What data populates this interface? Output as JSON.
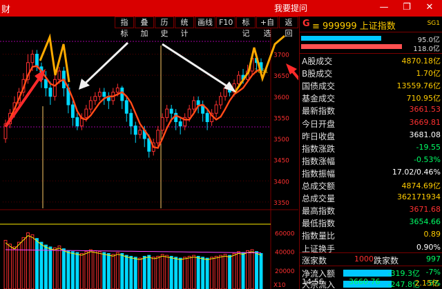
{
  "titlebar": {
    "app": "财",
    "help": "我要提问",
    "min": "—",
    "restore": "❐",
    "close": "✕"
  },
  "toolbar": {
    "items": [
      "指标",
      "叠加",
      "历史",
      "统计",
      "画线",
      "F10",
      "标记",
      "+自选",
      "返回"
    ]
  },
  "quote": {
    "market": "G",
    "code_name": "≡  999999  上证指数",
    "sg": "SG1",
    "bar1_value": "95.0亿",
    "bar2_value": "118.0亿"
  },
  "stats": [
    {
      "label": "A股成交",
      "value": "4870.18亿",
      "color": "#ffcc00"
    },
    {
      "label": "B股成交",
      "value": "1.70亿",
      "color": "#ffcc00"
    },
    {
      "label": "国债成交",
      "value": "13559.76亿",
      "color": "#ffcc00"
    },
    {
      "label": "基金成交",
      "value": "710.95亿",
      "color": "#ffcc00"
    },
    {
      "label": "最新指数",
      "value": "3661.53",
      "color": "#ff3030"
    },
    {
      "label": "今日开盘",
      "value": "3669.81",
      "color": "#ff3030"
    },
    {
      "label": "昨日收盘",
      "value": "3681.08",
      "color": "#ffffff"
    },
    {
      "label": "指数涨跌",
      "value": "-19.55",
      "color": "#00ff66"
    },
    {
      "label": "指数涨幅",
      "value": "-0.53%",
      "color": "#00ff66"
    },
    {
      "label": "指数振幅",
      "value": "17.02/0.46%",
      "color": "#ffffff"
    },
    {
      "label": "总成交额",
      "value": "4874.69亿",
      "color": "#ffcc00"
    },
    {
      "label": "总成交量",
      "value": "362171934",
      "color": "#ffcc00"
    },
    {
      "label": "最高指数",
      "value": "3671.68",
      "color": "#ff3030"
    },
    {
      "label": "最低指数",
      "value": "3654.66",
      "color": "#00ff66"
    },
    {
      "label": "指数量比",
      "value": "0.89",
      "color": "#ffcc00"
    },
    {
      "label": "上证换手",
      "value": "0.90%",
      "color": "#ffffff"
    }
  ],
  "breadth": {
    "up_label": "涨家数",
    "up_value": "1000",
    "down_label": "跌家数",
    "down_value": "997"
  },
  "flows": [
    {
      "label": "净流入额",
      "value": "-319.3亿",
      "pct": "-7%"
    },
    {
      "label": "大宗流入",
      "value": "-247.8亿",
      "pct": "-5%"
    }
  ],
  "footer": {
    "time": "14:56",
    "price": "3660.76",
    "vol": "2.15亿"
  },
  "chart_data": {
    "type": "candlestick",
    "price_axis_ticks": [
      "3700",
      "3650",
      "3600",
      "3550",
      "3500",
      "3450",
      "3400",
      "3350"
    ],
    "last_label": "3661",
    "volume_axis_ticks": [
      "60000",
      "40000",
      "20000"
    ],
    "volume_unit_label": "X10",
    "candles": [
      [
        3500,
        3535,
        3490,
        3545
      ],
      [
        3535,
        3560,
        3525,
        3570
      ],
      [
        3560,
        3585,
        3550,
        3600
      ],
      [
        3585,
        3610,
        3575,
        3620
      ],
      [
        3610,
        3640,
        3600,
        3655
      ],
      [
        3640,
        3680,
        3630,
        3700
      ],
      [
        3680,
        3700,
        3660,
        3710
      ],
      [
        3700,
        3670,
        3660,
        3710
      ],
      [
        3670,
        3640,
        3620,
        3680
      ],
      [
        3640,
        3620,
        3600,
        3660
      ],
      [
        3620,
        3600,
        3580,
        3635
      ],
      [
        3600,
        3640,
        3590,
        3650
      ],
      [
        3640,
        3660,
        3630,
        3670
      ],
      [
        3660,
        3620,
        3600,
        3670
      ],
      [
        3620,
        3580,
        3560,
        3630
      ],
      [
        3580,
        3550,
        3530,
        3590
      ],
      [
        3550,
        3530,
        3520,
        3560
      ],
      [
        3530,
        3550,
        3520,
        3560
      ],
      [
        3550,
        3570,
        3540,
        3580
      ],
      [
        3570,
        3590,
        3560,
        3600
      ],
      [
        3590,
        3600,
        3580,
        3610
      ],
      [
        3600,
        3610,
        3590,
        3620
      ],
      [
        3610,
        3600,
        3580,
        3620
      ],
      [
        3600,
        3590,
        3570,
        3610
      ],
      [
        3590,
        3610,
        3580,
        3620
      ],
      [
        3610,
        3620,
        3600,
        3630
      ],
      [
        3620,
        3590,
        3570,
        3625
      ],
      [
        3590,
        3560,
        3540,
        3600
      ],
      [
        3560,
        3530,
        3510,
        3570
      ],
      [
        3530,
        3510,
        3490,
        3540
      ],
      [
        3510,
        3520,
        3500,
        3530
      ],
      [
        3520,
        3500,
        3480,
        3530
      ],
      [
        3500,
        3470,
        3455,
        3510
      ],
      [
        3470,
        3490,
        3460,
        3500
      ],
      [
        3490,
        3520,
        3480,
        3530
      ],
      [
        3520,
        3550,
        3510,
        3560
      ],
      [
        3550,
        3570,
        3540,
        3580
      ],
      [
        3570,
        3560,
        3540,
        3580
      ],
      [
        3560,
        3540,
        3520,
        3570
      ],
      [
        3540,
        3530,
        3510,
        3550
      ],
      [
        3530,
        3550,
        3520,
        3560
      ],
      [
        3550,
        3570,
        3540,
        3580
      ],
      [
        3570,
        3590,
        3560,
        3600
      ],
      [
        3590,
        3580,
        3560,
        3600
      ],
      [
        3580,
        3560,
        3540,
        3590
      ],
      [
        3560,
        3540,
        3520,
        3570
      ],
      [
        3540,
        3560,
        3530,
        3570
      ],
      [
        3560,
        3580,
        3550,
        3590
      ],
      [
        3580,
        3600,
        3570,
        3610
      ],
      [
        3600,
        3620,
        3590,
        3630
      ],
      [
        3620,
        3610,
        3600,
        3630
      ],
      [
        3610,
        3630,
        3600,
        3640
      ],
      [
        3630,
        3650,
        3620,
        3660
      ],
      [
        3650,
        3640,
        3630,
        3665
      ],
      [
        3640,
        3660,
        3635,
        3675
      ],
      [
        3660,
        3690,
        3650,
        3700
      ],
      [
        3690,
        3680,
        3660,
        3700
      ],
      [
        3680,
        3662,
        3655,
        3690
      ]
    ],
    "ma_line": [
      3530,
      3548,
      3570,
      3595,
      3620,
      3650,
      3670,
      3672,
      3660,
      3645,
      3630,
      3625,
      3635,
      3640,
      3620,
      3595,
      3565,
      3548,
      3545,
      3555,
      3570,
      3585,
      3595,
      3600,
      3600,
      3605,
      3610,
      3600,
      3585,
      3560,
      3535,
      3520,
      3505,
      3480,
      3478,
      3500,
      3525,
      3545,
      3555,
      3550,
      3545,
      3545,
      3560,
      3578,
      3580,
      3570,
      3555,
      3545,
      3552,
      3570,
      3590,
      3605,
      3612,
      3620,
      3635,
      3650,
      3660,
      3665
    ],
    "volume": [
      52000,
      48000,
      45000,
      50000,
      55000,
      60000,
      58000,
      54000,
      50000,
      47000,
      45000,
      44000,
      46000,
      43000,
      41000,
      40000,
      39000,
      38000,
      40000,
      42000,
      41000,
      40000,
      39000,
      38000,
      37000,
      39000,
      38000,
      36000,
      35000,
      34000,
      33000,
      35000,
      36000,
      34000,
      35000,
      37000,
      36000,
      35000,
      34000,
      33000,
      34000,
      35000,
      36000,
      35000,
      34000,
      33000,
      34000,
      35000,
      36000,
      37000,
      36000,
      38000,
      40000,
      39000,
      41000,
      42000,
      40000,
      38000
    ]
  }
}
